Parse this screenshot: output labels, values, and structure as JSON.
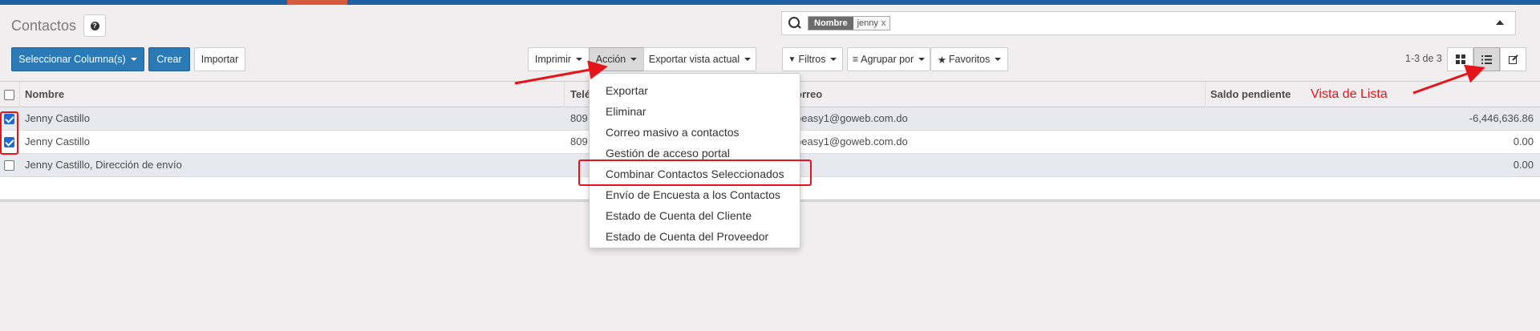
{
  "page": {
    "title": "Contactos",
    "help_icon": "question-circle-icon"
  },
  "search": {
    "facet_category": "Nombre",
    "facet_value": "jenny",
    "facet_remove": "x"
  },
  "toolbar": {
    "select_columns_label": "Seleccionar Columna(s)",
    "create_label": "Crear",
    "import_label": "Importar",
    "print_label": "Imprimir",
    "action_label": "Acción",
    "export_view_label": "Exportar vista actual",
    "filters_label": "Filtros",
    "group_by_label": "Agrupar por",
    "favorites_label": "Favoritos",
    "pager": "1-3 de 3"
  },
  "table": {
    "columns": {
      "name": "Nombre",
      "phone": "Telé",
      "email": "orreo",
      "balance": "Saldo pendiente"
    },
    "rows": [
      {
        "name": "Jenny Castillo",
        "phone": "809",
        "email": "peasy1@goweb.com.do",
        "balance": "-6,446,636.86",
        "checked": true
      },
      {
        "name": "Jenny Castillo",
        "phone": "809",
        "email": "peasy1@goweb.com.do",
        "balance": "0.00",
        "checked": true
      },
      {
        "name": "Jenny Castillo, Dirección de envío",
        "phone": "",
        "email": "",
        "balance": "0.00",
        "checked": false
      }
    ]
  },
  "action_menu": {
    "items": [
      "Exportar",
      "Eliminar",
      "Correo masivo a contactos",
      "Gestión de acceso portal",
      "Combinar Contactos Seleccionados",
      "Envío de Encuesta a los Contactos",
      "Estado de Cuenta del Cliente",
      "Estado de Cuenta del Proveedor"
    ],
    "highlighted_index": 4
  },
  "annotation": {
    "list_view_label": "Vista de Lista"
  },
  "colors": {
    "primary": "#2a7ab7",
    "topbar": "#1f5fa4",
    "annotation_red": "#e4141b",
    "checkbox_blue": "#1e6ad6"
  }
}
